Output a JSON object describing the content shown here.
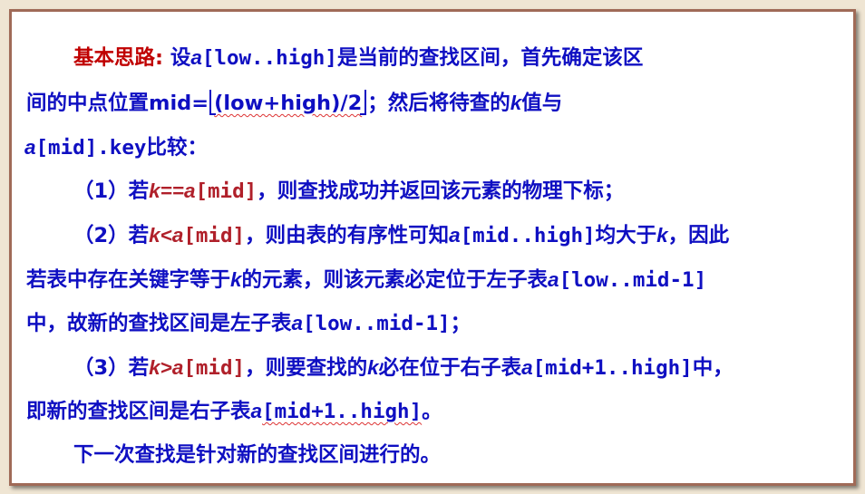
{
  "slide": {
    "line1": {
      "heading": "基本思路:",
      "t1": "设",
      "a": "a",
      "range": "[low..high]",
      "t2": "是当前的查找区间，首先确定该区"
    },
    "line2": {
      "t1": "间的中点位置mid=",
      "floor_expr": "(low+high)/2",
      "t2": "；然后将待查的",
      "k": "k",
      "t3": "值与"
    },
    "line3": {
      "a": "a",
      "t1": "[mid].key",
      "t2": "比较："
    },
    "line4": {
      "num": "（1）若",
      "cond_k": "k==",
      "cond_a": "a",
      "cond_mid": "[mid]",
      "t1": "，则查找成功并返回该元素的物理下标；"
    },
    "line5": {
      "num": "（2）若",
      "cond_k": "k<",
      "cond_a": "a",
      "cond_mid": "[mid]",
      "t1": "，则由表的有序性可知",
      "a": "a",
      "range": "[mid..high]",
      "t2": "均大于",
      "k": "k",
      "t3": "，因此"
    },
    "line6": {
      "t1": "若表中存在关键字等于",
      "k": "k",
      "t2": "的元素，则该元素必定位于左子表",
      "a": "a",
      "range": "[low..mid-1]"
    },
    "line7": {
      "t1": "中，故新的查找区间是左子表",
      "a": "a",
      "range": "[low..mid-1]",
      "t2": "；"
    },
    "line8": {
      "num": "（3）若",
      "cond_k": "k>",
      "cond_a": "a",
      "cond_mid": "[mid]",
      "t1": "，则要查找的",
      "k": "k",
      "t2": "必在位于右子表",
      "a": "a",
      "range": "[mid+1..high]",
      "t3": "中，"
    },
    "line9": {
      "t1": "即新的查找区间是右子表",
      "a": "a",
      "range": "[mid+1..high]",
      "t2": "。"
    },
    "line10": {
      "t1": "下一次查找是针对新的查找区间进行的。"
    }
  }
}
